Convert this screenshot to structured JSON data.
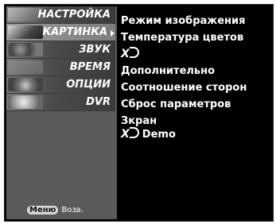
{
  "sidebar": {
    "items": [
      {
        "label": "НАСТРОЙКА",
        "icon": "satellite-dish-icon"
      },
      {
        "label": "КАРТИНКА",
        "icon": "film-picture-icon",
        "active": true
      },
      {
        "label": "ЗВУК",
        "icon": "speaker-icon"
      },
      {
        "label": "ВРЕМЯ",
        "icon": "clock-icon"
      },
      {
        "label": "ОПЦИИ",
        "icon": "special-gear-icon"
      },
      {
        "label": "DVR",
        "icon": "disc-icon"
      }
    ],
    "footer": {
      "key": "Меню",
      "action": "Возв."
    }
  },
  "options": [
    {
      "label": "Режим изображения"
    },
    {
      "label": "Температура цветов"
    },
    {
      "label": "XD",
      "logo": true
    },
    {
      "label": "Дополнительно"
    },
    {
      "label": "Соотношение сторон"
    },
    {
      "label": "Сброс параметров"
    },
    {
      "label": "Зкран"
    },
    {
      "label": "XD",
      "logo": true,
      "suffix": "Demo"
    }
  ],
  "colors": {
    "background": "#000000",
    "sidebar": "#5a5a5a",
    "active_item": "#8e8e8e",
    "text": "#ffffff"
  }
}
